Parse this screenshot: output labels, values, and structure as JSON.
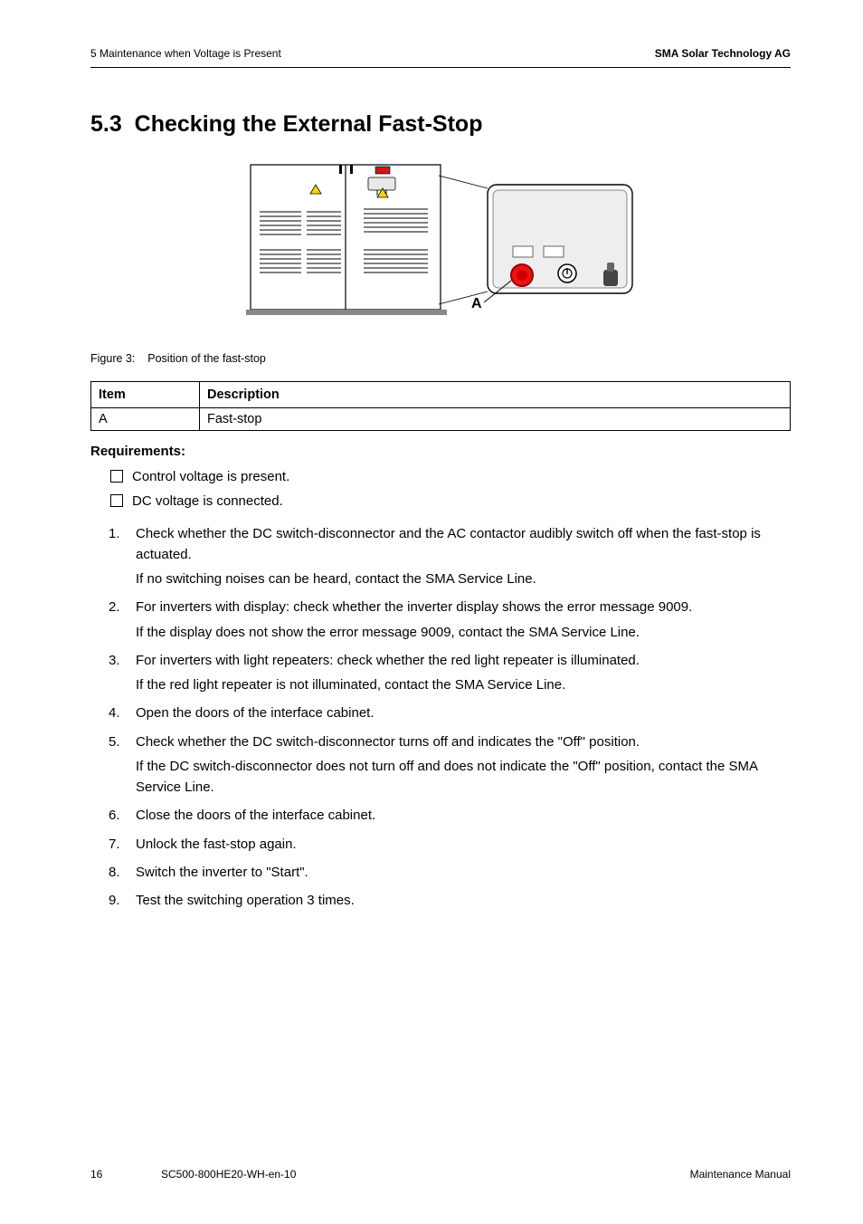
{
  "header": {
    "left": "5 Maintenance when Voltage is Present",
    "right": "SMA Solar Technology AG"
  },
  "section": {
    "number": "5.3",
    "title": "Checking the External Fast-Stop"
  },
  "figure": {
    "label_a": "A",
    "caption_prefix": "Figure 3:",
    "caption_text": "Position of the fast-stop"
  },
  "table": {
    "headers": {
      "item": "Item",
      "desc": "Description"
    },
    "rows": [
      {
        "item": "A",
        "desc": "Fast-stop"
      }
    ]
  },
  "requirements": {
    "title": "Requirements:",
    "items": [
      "Control voltage is present.",
      "DC voltage is connected."
    ]
  },
  "steps": [
    {
      "main": "Check whether the DC switch-disconnector and the AC contactor audibly switch off when the fast-stop is actuated.",
      "sub": "If no switching noises can be heard, contact the SMA Service Line."
    },
    {
      "main": "For inverters with display: check whether the inverter display shows the error message 9009.",
      "sub": "If the display does not show the error message 9009, contact the SMA Service Line."
    },
    {
      "main": "For inverters with light repeaters: check whether the red light repeater is illuminated.",
      "sub": "If the red light repeater is not illuminated, contact the SMA Service Line."
    },
    {
      "main": "Open the doors of the interface cabinet."
    },
    {
      "main": "Check whether the DC switch-disconnector turns off and indicates the \"Off\" position.",
      "sub": "If the DC switch-disconnector does not turn off and does not indicate the \"Off\" position, contact the SMA Service Line."
    },
    {
      "main": "Close the doors of the interface cabinet."
    },
    {
      "main": "Unlock the fast-stop again."
    },
    {
      "main": "Switch the inverter to \"Start\"."
    },
    {
      "main": "Test the switching operation 3 times."
    }
  ],
  "footer": {
    "page": "16",
    "code": "SC500-800HE20-WH-en-10",
    "type": "Maintenance Manual"
  }
}
